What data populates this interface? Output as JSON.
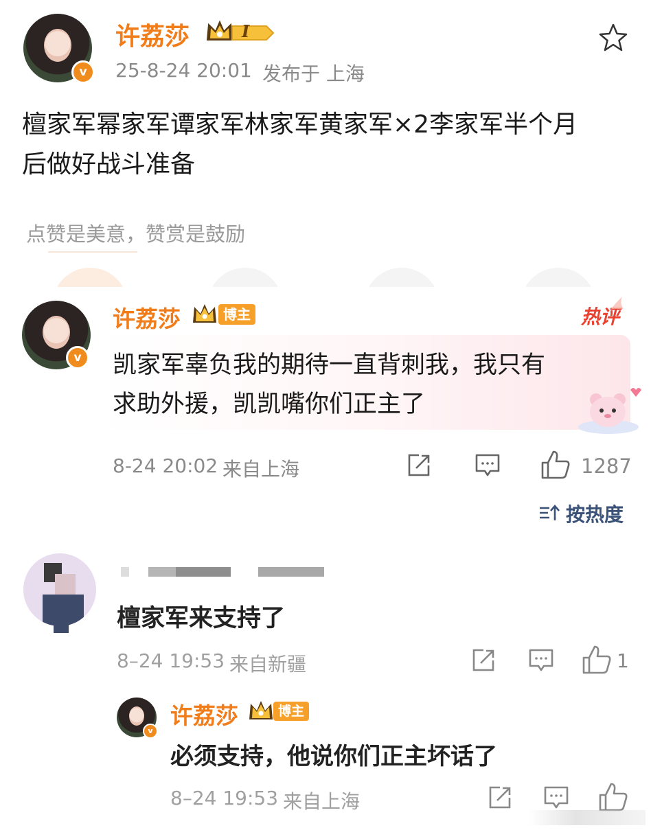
{
  "post": {
    "author": "许荔莎",
    "level": "I",
    "timestamp": "25-8-24 20:01",
    "published_from": "发布于 上海",
    "body_line1": "檀家军幂家军谭家军林家军黄家军×2李家军半个月",
    "body_line2": "后做好战斗准备",
    "reward_hint": "点赞是美意，赞赏是鼓励"
  },
  "hot_comment": {
    "author": "许荔莎",
    "badge": "博主",
    "hot_label": "热评",
    "text_line1": "凯家军辜负我的期待一直背刺我，我只有",
    "text_line2": "求助外援，凯凯嘴你们正主了",
    "timestamp": "8-24 20:02",
    "location": "来自上海",
    "likes": "1287"
  },
  "sort": {
    "label": "按热度"
  },
  "comment": {
    "text": "檀家军来支持了",
    "timestamp": "8–24 19:53",
    "location": "来自新疆",
    "likes": "1"
  },
  "reply": {
    "author": "许荔莎",
    "badge": "博主",
    "text": "必须支持，他说你们正主坏话了",
    "timestamp": "8–24 19:53",
    "location": "来自上海"
  },
  "colors": {
    "accent": "#f07d1a",
    "badge": "#f6a02a",
    "hot": "#e8412f",
    "meta": "#8a8a8a"
  },
  "icons": [
    "star-icon",
    "crown-icon",
    "share-icon",
    "comment-icon",
    "like-icon",
    "sort-icon"
  ]
}
